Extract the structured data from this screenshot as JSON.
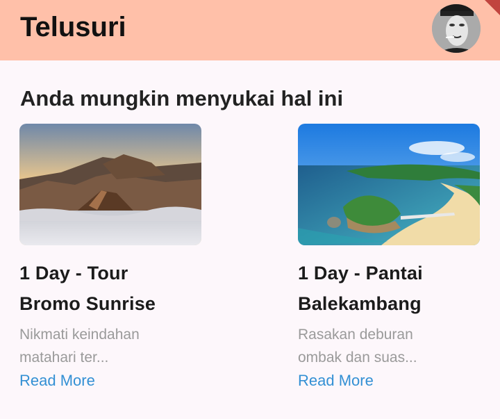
{
  "header": {
    "title": "Telusuri",
    "avatar_icon": "user-avatar",
    "background": "#ffc0a9"
  },
  "section": {
    "title": "Anda mungkin menyukai hal ini"
  },
  "cards": [
    {
      "title": "1 Day - Tour Bromo Sunrise",
      "description": "Nikmati keindahan matahari ter...",
      "action": "Read More",
      "image_icon": "bromo-mountain-image"
    },
    {
      "title": "1 Day - Pantai Balekambang",
      "description": "Rasakan deburan ombak dan suas...",
      "action": "Read More",
      "image_icon": "beach-island-image"
    }
  ],
  "colors": {
    "accent": "#3390d4",
    "background": "#fdf7fb"
  }
}
